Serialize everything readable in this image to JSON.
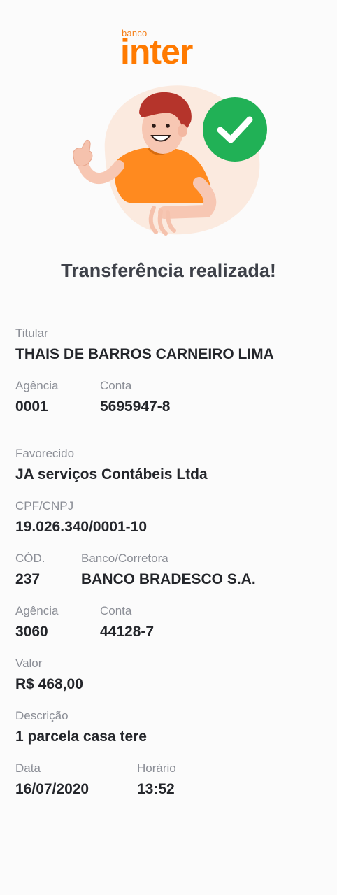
{
  "brand": {
    "small": "banco",
    "name": "inter"
  },
  "status": {
    "title": "Transferência realizada!"
  },
  "origin": {
    "titular_label": "Titular",
    "titular": "THAIS DE BARROS CARNEIRO LIMA",
    "agencia_label": "Agência",
    "agencia": "0001",
    "conta_label": "Conta",
    "conta": "5695947-8"
  },
  "recipient": {
    "favorecido_label": "Favorecido",
    "favorecido": "JA serviços Contábeis Ltda",
    "cpf_label": "CPF/CNPJ",
    "cpf": "19.026.340/0001-10",
    "cod_label": "CÓD.",
    "cod": "237",
    "banco_label": "Banco/Corretora",
    "banco": "BANCO BRADESCO S.A.",
    "agencia_label": "Agência",
    "agencia": "3060",
    "conta_label": "Conta",
    "conta": "44128-7",
    "valor_label": "Valor",
    "valor": "R$ 468,00",
    "descricao_label": "Descrição",
    "descricao": "1 parcela casa tere",
    "data_label": "Data",
    "data": "16/07/2020",
    "horario_label": "Horário",
    "horario": "13:52"
  },
  "colors": {
    "brand": "#ff7a00",
    "success": "#21b156"
  },
  "icons": {
    "success": "check-circle-icon"
  }
}
